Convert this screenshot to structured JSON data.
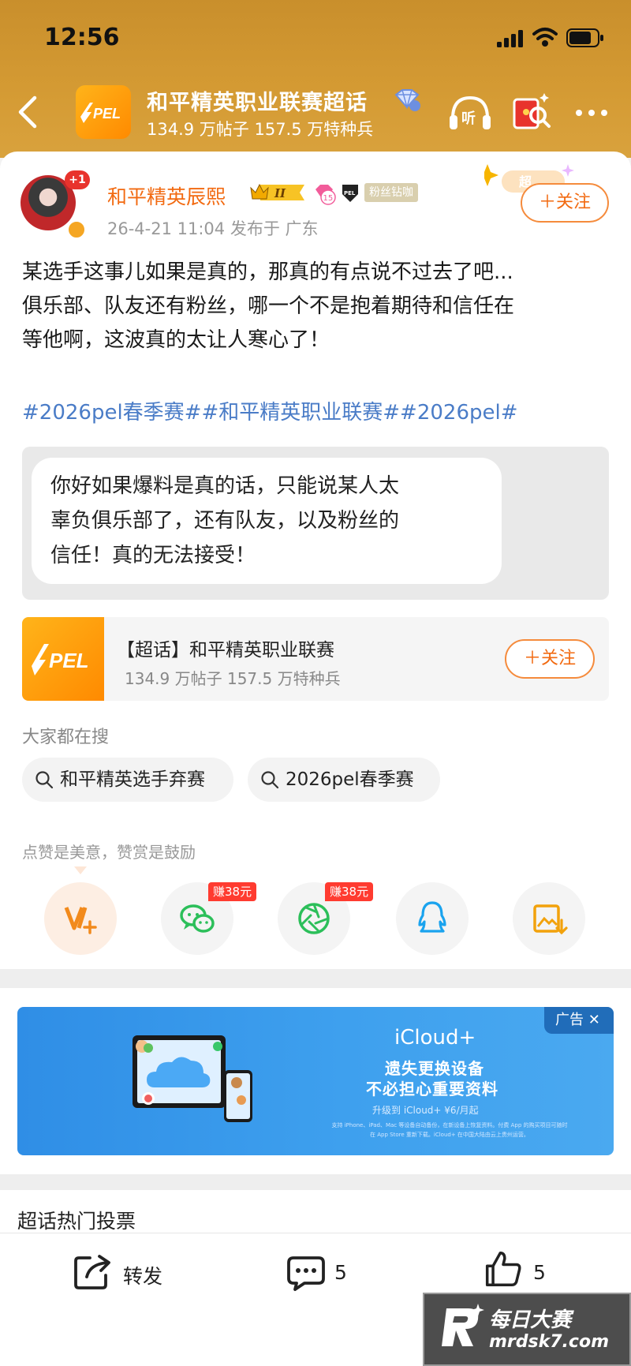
{
  "status_bar": {
    "time": "12:56"
  },
  "header": {
    "logo_text": "PEL",
    "title": "和平精英职业联赛超话",
    "stats": "134.9 万帖子 157.5 万特种兵"
  },
  "post": {
    "author": "和平精英辰熙",
    "avatar_badge": "+1",
    "level_badge": "II",
    "fan_level": "15",
    "fan_tag": "粉丝钻咖",
    "meta": "26-4-21 11:04  发布于 广东",
    "follow_label": "＋关注",
    "deco_text": "超",
    "text_lines": [
      "某选手这事儿如果是真的，那真的有点说不过去了吧...",
      "俱乐部、队友还有粉丝，哪一个不是抱着期待和信任在",
      "等他啊，这波真的太让人寒心了！"
    ],
    "hashtags": "#2026pel春季赛##和平精英职业联赛##2026pel#",
    "quote_lines": [
      "你好如果爆料是真的话，只能说某人太",
      "辜负俱乐部了，还有队友，以及粉丝的",
      "信任！真的无法接受！"
    ]
  },
  "topic_card": {
    "logo_text": "PEL",
    "name": "【超话】和平精英职业联赛",
    "stats": "134.9 万帖子 157.5 万特种兵",
    "follow_label": "＋关注"
  },
  "search": {
    "title": "大家都在搜",
    "chips": [
      "和平精英选手弃赛",
      "2026pel春季赛"
    ]
  },
  "reward": {
    "title": "点赞是美意，赞赏是鼓励",
    "earn_tags": [
      "赚38元",
      "赚38元"
    ]
  },
  "ad": {
    "label": "广告 ✕",
    "brand": "iCloud+",
    "line1": "遗失更换设备",
    "line2": "不必担心重要资料",
    "price": "升级到 iCloud+  ¥6/月起",
    "fine_print": "支持 iPhone、iPad、Mac 等设备自动备份，在新设备上恢复资料。付费 App 的购买项目可随时在 App Store 重新下载。iCloud+ 在中国大陆由云上贵州运营。"
  },
  "vote": {
    "title": "超话热门投票"
  },
  "bottom_bar": {
    "repost_label": "转发",
    "comment_count": "5",
    "like_count": "5"
  },
  "watermark": {
    "cn": "每日大赛",
    "en": "mrdsk7.com"
  },
  "colors": {
    "accent": "#f26a11",
    "header": "#d49a33",
    "link": "#4a7cc7",
    "ad_blue": "#3ea0ee"
  }
}
